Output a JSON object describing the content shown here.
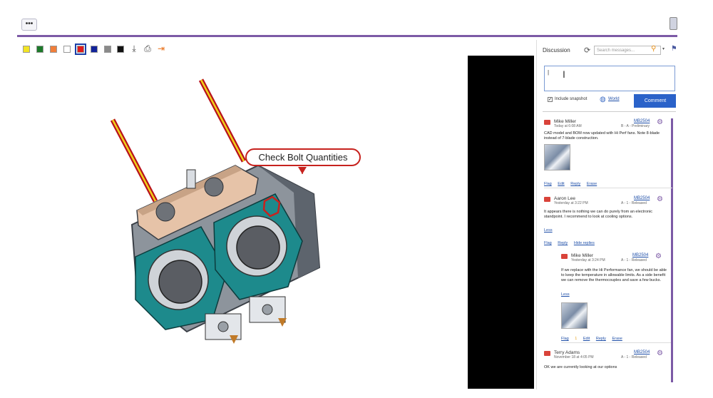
{
  "toolbar": {
    "more_label": "•••",
    "colors": [
      "#f2e424",
      "#1d7a2a",
      "#f07e3a",
      "#ffffff",
      "#e01b1b",
      "#12239a",
      "#8a8a8a",
      "#111111"
    ],
    "selected_color": "#e01b1b",
    "tools": [
      "download-icon",
      "print-icon",
      "export-icon"
    ]
  },
  "callout": {
    "text": "Check Bolt Quantities"
  },
  "discussion": {
    "title": "Discussion",
    "search_placeholder": "Search messages...",
    "comment_cursor": "|",
    "include_snapshot_label": "Include snapshot",
    "visibility_label": "World",
    "comment_button": "Comment",
    "posts": [
      {
        "author": "Mike Miller",
        "time": "Today at 6:08 AM",
        "version": "MB2504",
        "state": "B - A - Preliminary",
        "body": "CAD model and BOM now updated with Hi Perf fans. Note 8-blade instead of 7-blade construction.",
        "actions": [
          "Flag",
          "Edit",
          "Reply",
          "Erase"
        ]
      },
      {
        "author": "Aaron Lee",
        "time": "Yesterday at 3:22 PM",
        "version": "MB2504",
        "state": "A - 1 - Released",
        "body": "It appears there is nothing we can do purely from an electronic standpoint. I recommend to look at cooling options.",
        "less": "Less",
        "actions": [
          "Flag",
          "Reply",
          "Hide replies"
        ]
      },
      {
        "author": "Mike Miller",
        "time": "Yesterday at 3:24 PM",
        "version": "MB2504",
        "state": "A - 1 - Released",
        "body": "If we replace with the Hi Performance fan, we should be able to keep the temperature in allowable limits. As a side benefit we can remove the thermocouples and save a few bucks.",
        "less": "Less",
        "flag_count": "1",
        "actions": [
          "Flag",
          "Edit",
          "Reply",
          "Erase"
        ]
      },
      {
        "author": "Terry Adams",
        "time": "November 18 at 4:05 PM",
        "version": "MB2504",
        "state": "A - 1 - Released",
        "body": "OK we are currently looking at our options"
      }
    ]
  }
}
